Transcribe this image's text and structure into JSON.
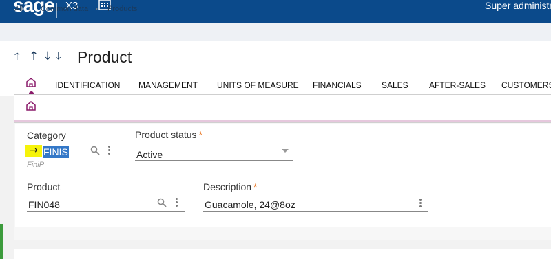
{
  "app": {
    "logo": "sage",
    "product": "X3",
    "user": "Super administrator"
  },
  "breadcrumb": [
    "All",
    "Common data",
    "Products"
  ],
  "page": {
    "title": "Product"
  },
  "tabs": [
    "IDENTIFICATION",
    "MANAGEMENT",
    "UNITS OF MEASURE",
    "FINANCIALS",
    "SALES",
    "AFTER-SALES",
    "CUSTOMERS"
  ],
  "form": {
    "category": {
      "label": "Category",
      "value": "FINIS",
      "hint": "FiniP"
    },
    "product_status": {
      "label": "Product status",
      "required": "*",
      "value": "Active"
    },
    "product": {
      "label": "Product",
      "value": "FIN048"
    },
    "description": {
      "label": "Description",
      "required": "*",
      "value": "Guacamole, 24@8oz"
    }
  },
  "colors": {
    "topbar": "#0b4a8b",
    "accent": "#8a1a6a",
    "required": "#e8711b",
    "highlight": "#f6f30a",
    "selection": "#3478c8"
  },
  "icons": [
    "calendar-icon",
    "chevron-right-icon",
    "first-record-icon",
    "previous-record-icon",
    "next-record-icon",
    "last-record-icon",
    "home-icon",
    "search-icon",
    "more-icon",
    "dropdown-arrow-icon",
    "arrow-right-icon"
  ]
}
